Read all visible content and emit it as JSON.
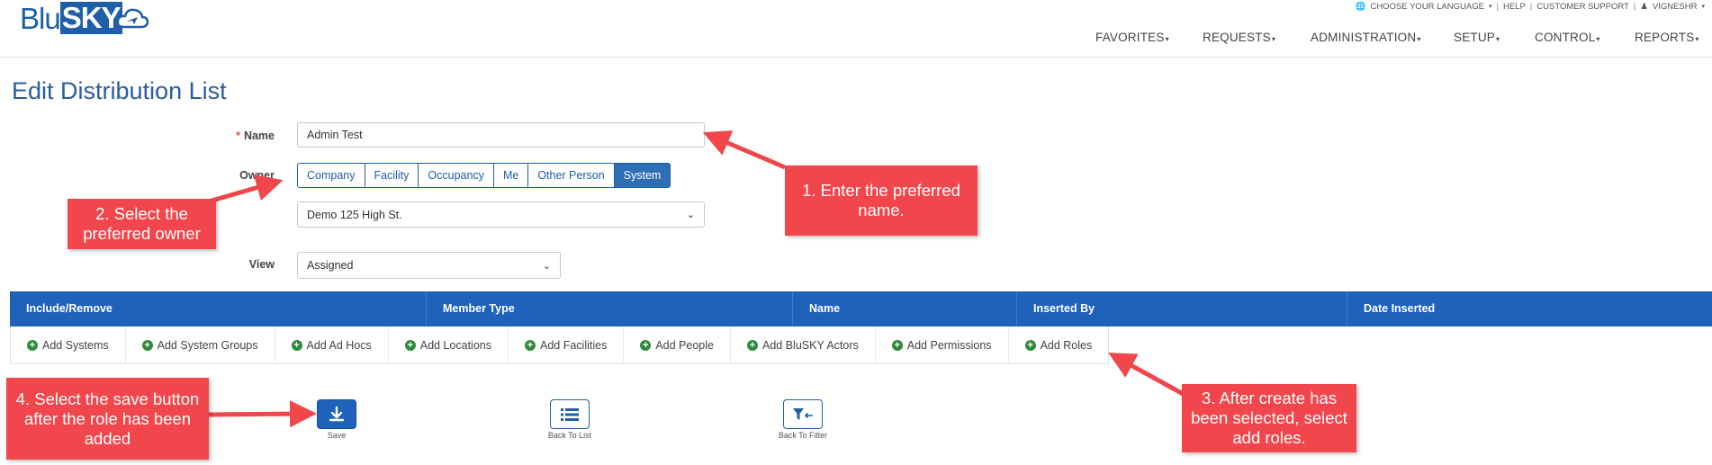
{
  "header": {
    "logo": {
      "blu": "Blu",
      "sky": "SKY"
    },
    "util": {
      "language": "CHOOSE YOUR LANGUAGE",
      "help": "HELP",
      "support": "CUSTOMER SUPPORT",
      "user": "VIGNESHR"
    },
    "nav": [
      "FAVORITES",
      "REQUESTS",
      "ADMINISTRATION",
      "SETUP",
      "CONTROL",
      "REPORTS"
    ]
  },
  "page": {
    "title": "Edit Distribution List"
  },
  "form": {
    "name_label": "Name",
    "name_value": "Admin Test",
    "owner_label": "Owner",
    "owner_options": [
      "Company",
      "Facility",
      "Occupancy",
      "Me",
      "Other Person",
      "System"
    ],
    "owner_selected": "System",
    "owner_select_value": "Demo 125 High St.",
    "view_label": "View",
    "view_value": "Assigned"
  },
  "table": {
    "columns": [
      "Include/Remove",
      "Member Type",
      "Name",
      "Inserted By",
      "Date Inserted"
    ]
  },
  "add_actions": [
    "Add Systems",
    "Add System Groups",
    "Add Ad Hocs",
    "Add Locations",
    "Add Facilities",
    "Add People",
    "Add BluSKY Actors",
    "Add Permissions",
    "Add Roles"
  ],
  "actions": {
    "save": "Save",
    "back_to_list": "Back To List",
    "back_to_filter": "Back To Filter"
  },
  "callouts": {
    "c1": "1. Enter the preferred name.",
    "c2": "2. Select the preferred owner",
    "c3": "3. After create has been selected, select add roles.",
    "c4": "4. Select the save button after the role has been added"
  },
  "colors": {
    "brand": "#1f5fa8",
    "table_header": "#1f62b9",
    "callout": "#f1464b",
    "add_icon": "#2e8b3a"
  }
}
